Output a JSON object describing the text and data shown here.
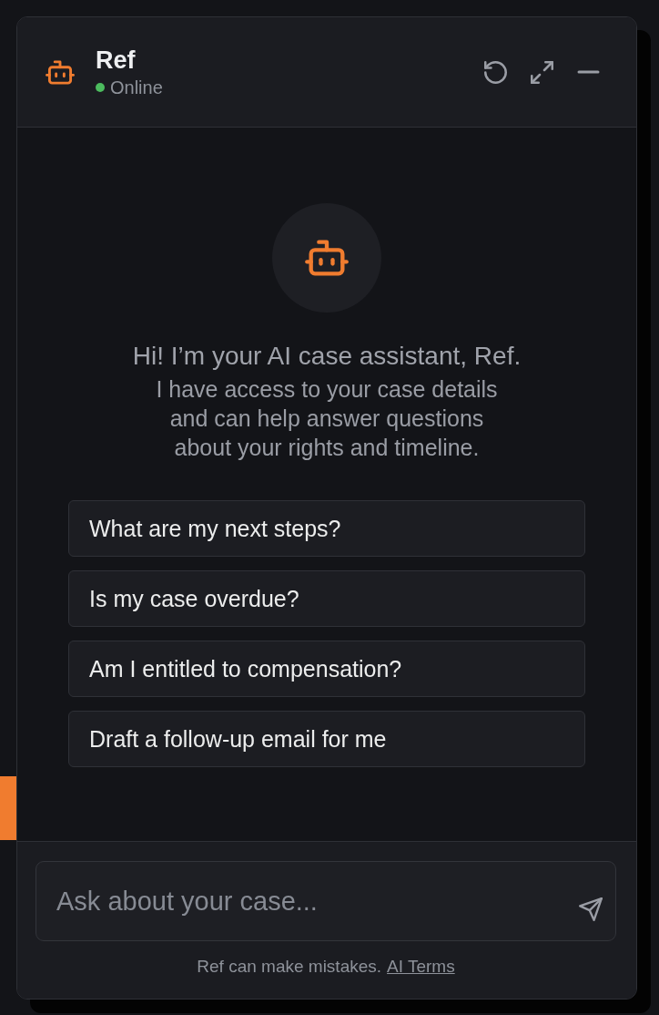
{
  "header": {
    "title": "Ref",
    "status": {
      "label": "Online",
      "online": true
    }
  },
  "welcome": {
    "heading": "Hi! I’m your AI case assistant, Ref.",
    "message": "I have access to your case details and can help answer questions about your rights and timeline."
  },
  "suggestions": [
    "What are my next steps?",
    "Is my case overdue?",
    "Am I entitled to compensation?",
    "Draft a follow-up email for me"
  ],
  "composer": {
    "placeholder": "Ask about your case..."
  },
  "footer": {
    "disclaimer": "Ref can make mistakes.",
    "link": "AI Terms"
  }
}
